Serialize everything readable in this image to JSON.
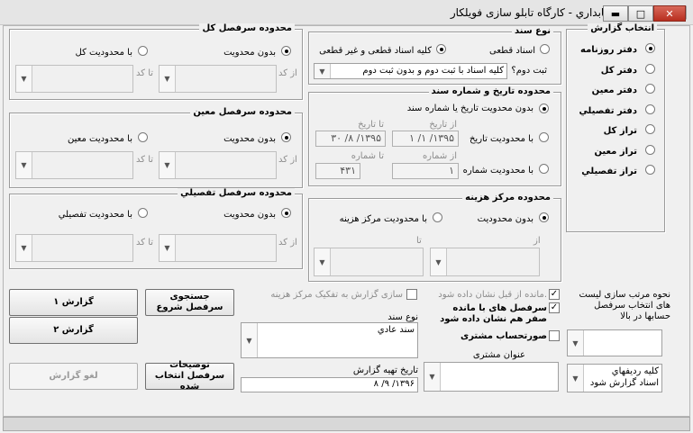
{
  "window": {
    "title": "گزارشات حسابداري  - کارگاه تابلو سازی فویلکار",
    "buttons": {
      "minimize": "▬",
      "maximize": "□",
      "close": "✕"
    }
  },
  "report_select": {
    "title": "انتخاب گزارش",
    "items": [
      "دفتر روزنامه",
      "دفتر کل",
      "دفتر معين",
      "دفتر تفصيلي",
      "تراز کل",
      "تراز معين",
      "تراز تفصيلي"
    ],
    "selected_index": 0
  },
  "doc_type": {
    "title": "نوع سند",
    "opt_final": "اسناد قطعی",
    "opt_all": "کليه اسناد قطعی و غير قطعی",
    "second_label": "ثبت دوم؟",
    "second_value": "کليه اسناد با ثبت دوم و بدون ثبت دوم"
  },
  "date_range": {
    "title": "محدوده تاريخ و شماره سند",
    "opt_none": "بدون محدويت تاريخ يا شماره سند",
    "opt_date": "با محدوديت تاريخ",
    "opt_number": "با محدوديت شماره",
    "from_date_label": "از تاريخ",
    "to_date_label": "تا تاريخ",
    "from_date": "۱۳۹۵/ ۱/ ۱",
    "to_date": "۱۳۹۵/ ۸/ ۳۰",
    "from_no_label": "از شماره",
    "to_no_label": "تا شماره",
    "from_no": "۱",
    "to_no": "۴۳۱"
  },
  "cost_center": {
    "title": "محدوده مرکز هزينه",
    "opt_none": "بدون محدوديت",
    "opt_with": "با محدوديت مرکز هزينه",
    "from": "از",
    "to": "تا"
  },
  "ledger_total": {
    "title": "محدوده سرفصل کل",
    "opt_none": "بدون محدويت",
    "opt_with": "با محدوديت کل",
    "from": "از کد",
    "to": "تا کد"
  },
  "ledger_moin": {
    "title": "محدوده سرفصل معين",
    "opt_none": "بدون محدويت",
    "opt_with": "با محدوديت معين",
    "from": "از کد",
    "to": "تا کد"
  },
  "ledger_tafsili": {
    "title": "محدوده سرفصل تفصيلي",
    "opt_none": "بدون محدويت",
    "opt_with": "با محدوديت تفصيلي",
    "from": "از کد",
    "to": "تا کد"
  },
  "buttons": {
    "report1": "گزارش ۱",
    "report2": "گزارش ۲",
    "cancel": "لغو گزارش",
    "search_start": "جستجوی سرفصل شروع",
    "selected_desc": "توضيحات سرفصل انتخاب شده"
  },
  "options": {
    "remaining": "مانده از قبل نشان داده شود.",
    "cost_center_display": "سازی گزارش به تفکيک مرکز هزينه",
    "zero_balance": "سرفصل های با مانده صفر هم نشان داده شود",
    "customer_statement": "صورتحساب مشتری"
  },
  "sort_note": "نحوه مرتب سازی ليست های انتخاب سرفصل حسابها در بالا",
  "doc_kind": {
    "label": "نوع سند",
    "value": "سند عادي"
  },
  "print_date": {
    "label": "تاريخ تهيه گزارش",
    "value": "۱۳۹۶/ ۹/ ۸"
  },
  "customer_title": {
    "label": "عنوان مشتری"
  },
  "rows_option": {
    "line1": "کليه رديفهاي",
    "line2": "اسناد گزارش شود"
  }
}
